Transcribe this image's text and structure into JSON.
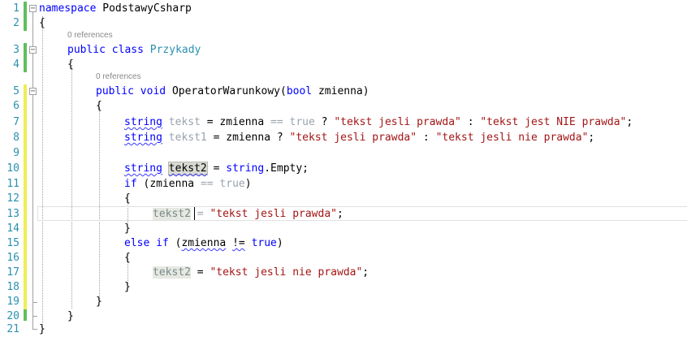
{
  "line_numbers": [
    "1",
    "2",
    "3",
    "4",
    "5",
    "6",
    "7",
    "8",
    "9",
    "10",
    "11",
    "12",
    "13",
    "14",
    "15",
    "16",
    "17",
    "18",
    "19",
    "20",
    "21"
  ],
  "references": [
    "0 references",
    "0 references"
  ],
  "code": {
    "namespace_kw": "namespace",
    "namespace_name": "PodstawyCsharp",
    "brace_open": "{",
    "brace_close": "}",
    "public_kw": "public",
    "class_kw": "class",
    "class_name": "Przykady",
    "void_kw": "void",
    "method_name": "OperatorWarunkowy(",
    "bool_kw": "bool",
    "param": "zmienna)",
    "string_kw": "string",
    "var_tekst": "tekst",
    "var_tekst1": "tekst1",
    "var_tekst2": "tekst2",
    "eq": "=",
    "zmienna": "zmienna",
    "eqeq": "==",
    "neq": "!=",
    "true_kw": "true",
    "question": "?",
    "colon": ":",
    "semicolon": ";",
    "str_prawda": "\"tekst jesli prawda\"",
    "str_nie_prawda": "\"tekst jest NIE prawda\"",
    "str_jesli_nie": "\"tekst jesli nie prawda\"",
    "string_type": "string",
    "empty_member": ".Empty;",
    "if_kw": "if",
    "else_kw": "else",
    "open_paren": "(",
    "close_paren": ")"
  },
  "colors": {
    "keyword": "#0000ff",
    "type": "#2b91af",
    "string": "#a31515",
    "line_number": "#2b91af",
    "change_saved": "#5fbf5f",
    "change_unsaved": "#eeee55"
  }
}
